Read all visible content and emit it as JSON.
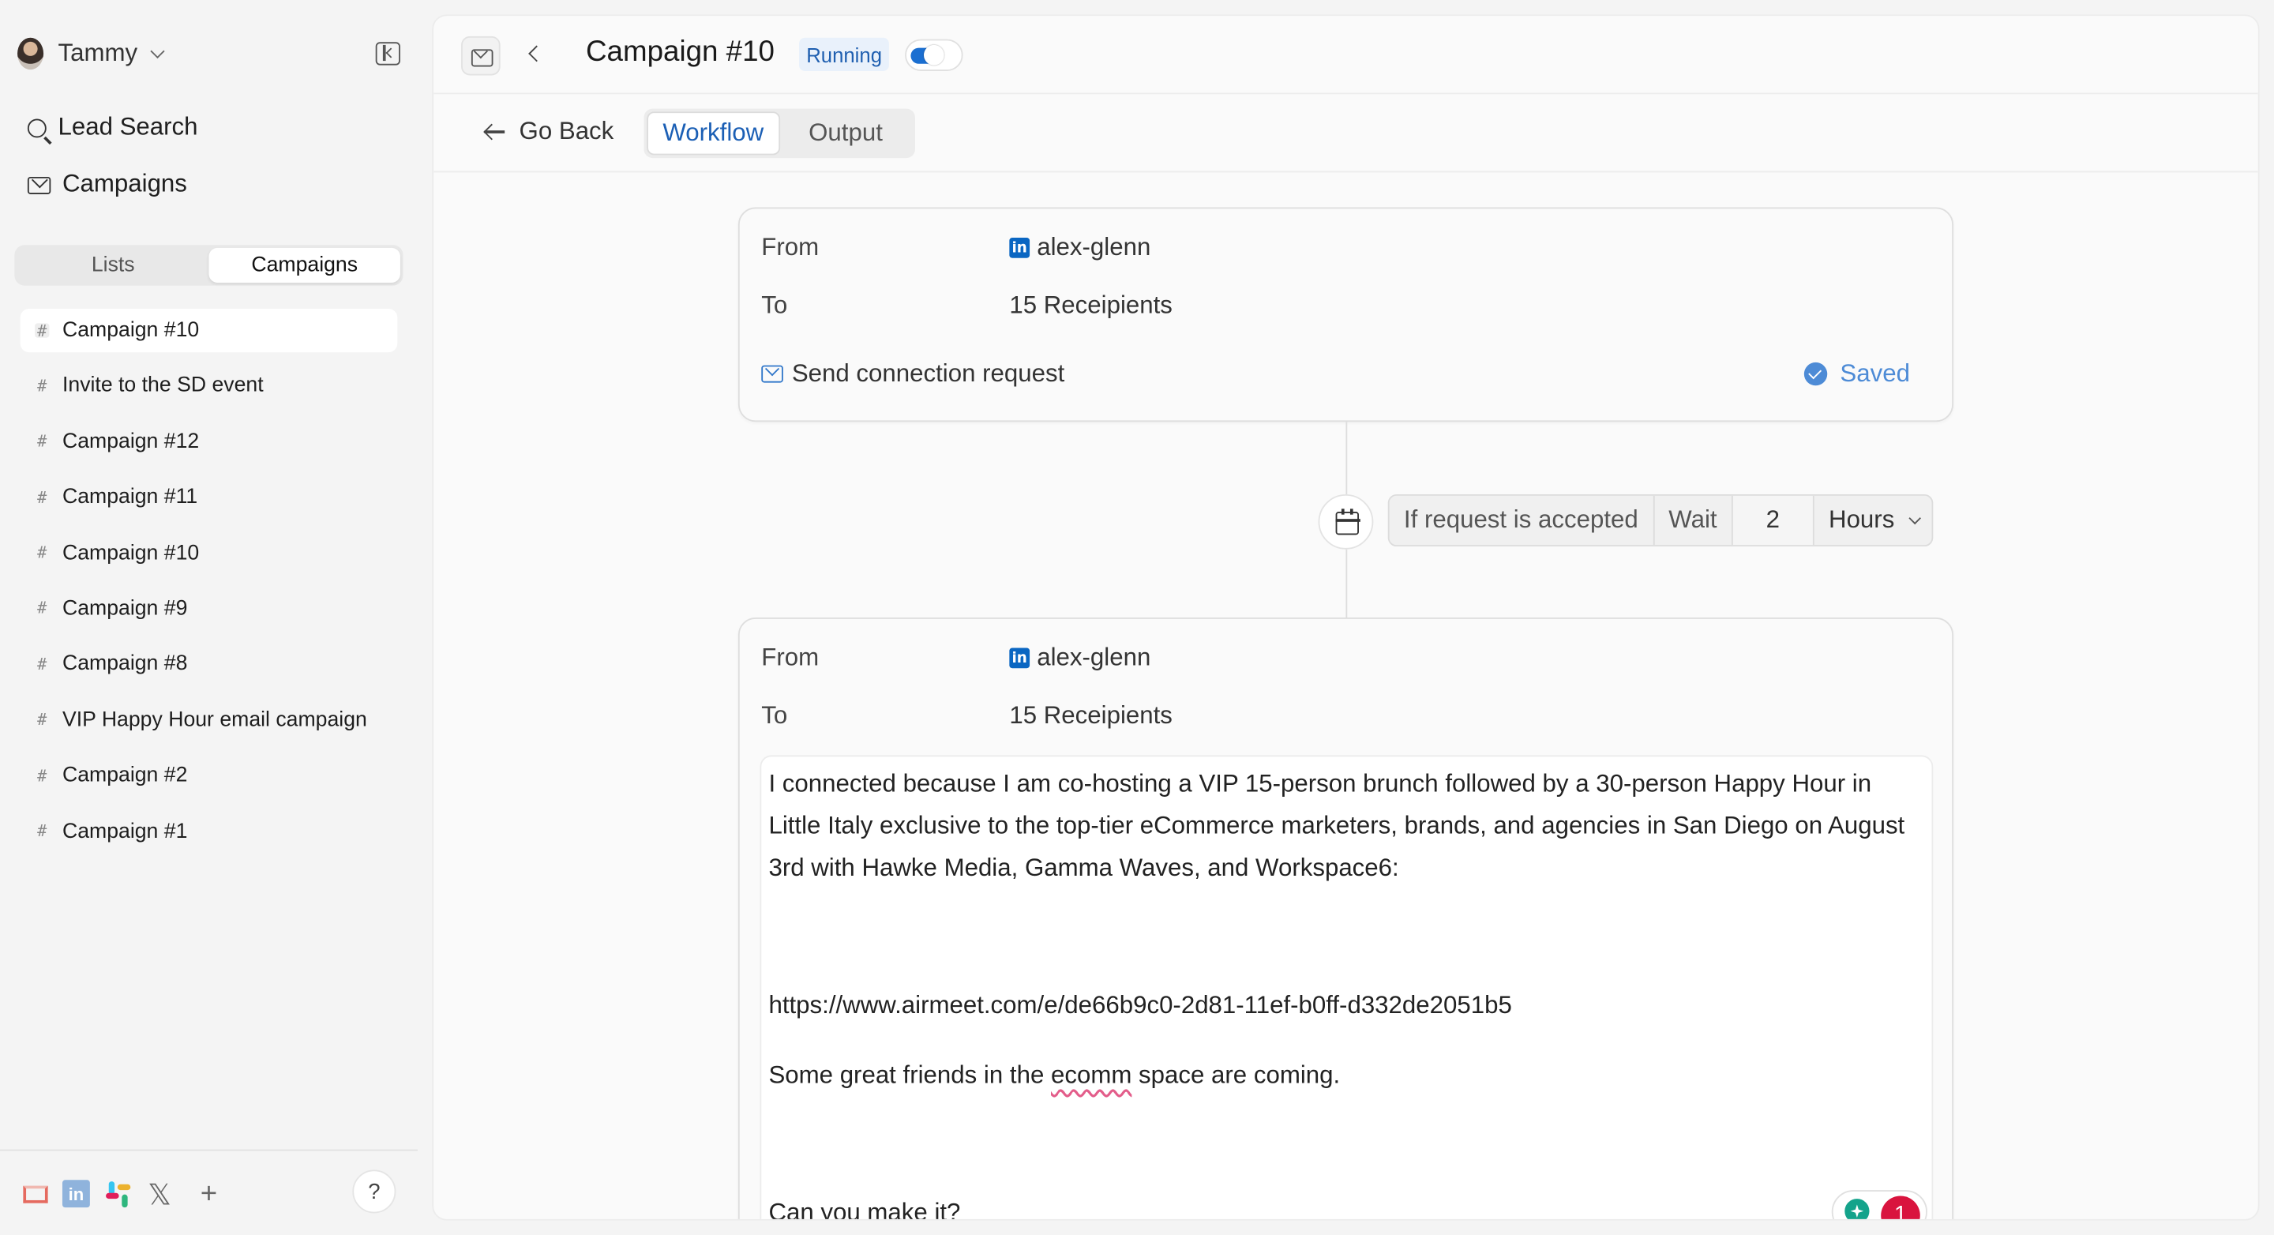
{
  "user": {
    "name": "Tammy"
  },
  "nav": [
    {
      "label": "Lead Search",
      "icon": "search-icon"
    },
    {
      "label": "Campaigns",
      "icon": "mail-icon"
    }
  ],
  "segment": {
    "lists": "Lists",
    "campaigns": "Campaigns",
    "selected": "Campaigns"
  },
  "campaigns": [
    "Campaign #10",
    "Invite to the SD event",
    "Campaign #12",
    "Campaign #11",
    "Campaign #10",
    "Campaign #9",
    "Campaign #8",
    "VIP Happy Hour email campaign",
    "Campaign #2",
    "Campaign #1"
  ],
  "footer": {
    "help": "?",
    "plus": "+",
    "linkedin": "in",
    "x": "𝕏"
  },
  "header": {
    "title": "Campaign #10",
    "status": "Running",
    "accent": "#1b6fd1"
  },
  "subnav": {
    "go_back": "Go Back",
    "tabs": [
      "Workflow",
      "Output"
    ],
    "active_tab": "Workflow"
  },
  "step1": {
    "from_label": "From",
    "from_value": "alex-glenn",
    "to_label": "To",
    "to_value": "15 Receipients",
    "action": "Send connection request",
    "saved": "Saved"
  },
  "condition": {
    "trigger": "If request is accepted",
    "wait": "Wait",
    "amount": "2",
    "unit": "Hours"
  },
  "step2": {
    "from_label": "From",
    "from_value": "alex-glenn",
    "to_label": "To",
    "to_value": "15 Receipients",
    "message": {
      "p1": "I connected because I am co-hosting a VIP 15-person brunch followed by a 30-person Happy Hour in Little Italy exclusive to the top-tier eCommerce marketers, brands, and agencies in San Diego on August 3rd with Hawke Media, Gamma Waves, and Workspace6:",
      "link": "https://www.airmeet.com/e/de66b9c0-2d81-11ef-b0ff-d332de2051b5",
      "p3_before": "Some great friends in the ",
      "p3_word": "ecomm",
      "p3_after": " space are coming.",
      "p4": "Can you make it?"
    },
    "grammar_issues": "1"
  }
}
